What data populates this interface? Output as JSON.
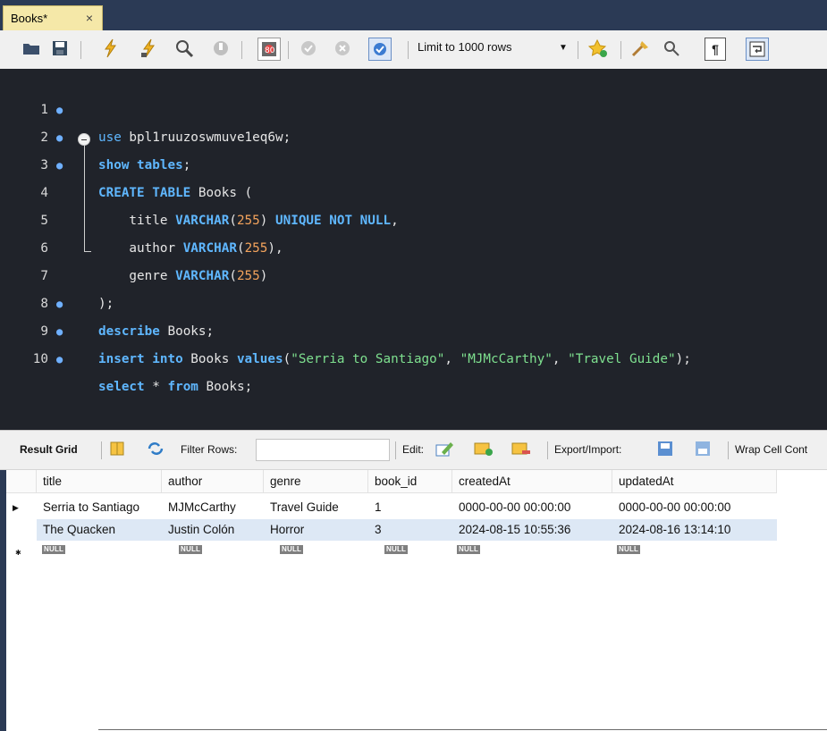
{
  "tab": {
    "label": "Books*",
    "close": "×"
  },
  "toolbar": {
    "limit_label": "Limit to 1000 rows",
    "icons": [
      "open-folder-icon",
      "save-icon",
      "execute-icon",
      "execute-current-icon",
      "explain-icon",
      "stop-icon",
      "toggle-error-icon",
      "commit-icon",
      "rollback-icon",
      "autocommit-icon",
      "limit-dropdown-icon",
      "add-snippet-icon",
      "beautify-icon",
      "find-icon",
      "invisibles-icon",
      "word-wrap-icon"
    ]
  },
  "editor": {
    "lines": [
      {
        "num": "1",
        "dot": true
      },
      {
        "num": "2",
        "dot": true
      },
      {
        "num": "3",
        "dot": true
      },
      {
        "num": "4",
        "dot": false
      },
      {
        "num": "5",
        "dot": false
      },
      {
        "num": "6",
        "dot": false
      },
      {
        "num": "7",
        "dot": false
      },
      {
        "num": "8",
        "dot": true
      },
      {
        "num": "9",
        "dot": true
      },
      {
        "num": "10",
        "dot": true
      }
    ],
    "tokens": {
      "l1_kw": "use",
      "l1_rest": " bpl1ruuzoswmuve1eq6w;",
      "l2_kw": "show tables",
      "l2_rest": ";",
      "l3_kw": "CREATE TABLE",
      "l3_rest": " Books (",
      "l4_a": "    title ",
      "l4_ty": "VARCHAR",
      "l4_p1": "(",
      "l4_num": "255",
      "l4_p2": ") ",
      "l4_kw": "UNIQUE NOT NULL",
      "l4_end": ",",
      "l5_a": "    author ",
      "l5_ty": "VARCHAR",
      "l5_p1": "(",
      "l5_num": "255",
      "l5_p2": "),",
      "l6_a": "    genre ",
      "l6_ty": "VARCHAR",
      "l6_p1": "(",
      "l6_num": "255",
      "l6_p2": ")",
      "l7": ");",
      "l8_kw": "describe",
      "l8_rest": " Books;",
      "l9_kw": "insert into",
      "l9_mid": " Books ",
      "l9_kw2": "values",
      "l9_p": "(",
      "l9_s1": "\"Serria to Santiago\"",
      "l9_c1": ", ",
      "l9_s2": "\"MJMcCarthy\"",
      "l9_c2": ", ",
      "l9_s3": "\"Travel Guide\"",
      "l9_end": ");",
      "l10_kw1": "select",
      "l10_star": " * ",
      "l10_kw2": "from",
      "l10_rest": " Books;"
    }
  },
  "results_toolbar": {
    "result_grid": "Result Grid",
    "filter_rows": "Filter Rows:",
    "filter_value": "",
    "edit": "Edit:",
    "export_import": "Export/Import:",
    "wrap": "Wrap Cell Cont"
  },
  "grid": {
    "columns": [
      "title",
      "author",
      "genre",
      "book_id",
      "createdAt",
      "updatedAt"
    ],
    "rows": [
      [
        "Serria to Santiago",
        "MJMcCarthy",
        "Travel Guide",
        "1",
        "0000-00-00 00:00:00",
        "0000-00-00 00:00:00"
      ],
      [
        "The Quacken",
        "Justin Colón",
        "Horror",
        "3",
        "2024-08-15 10:55:36",
        "2024-08-16 13:14:10"
      ]
    ],
    "null_label": "NULL",
    "current_row_marker": "▶",
    "new_row_marker": "✱"
  }
}
